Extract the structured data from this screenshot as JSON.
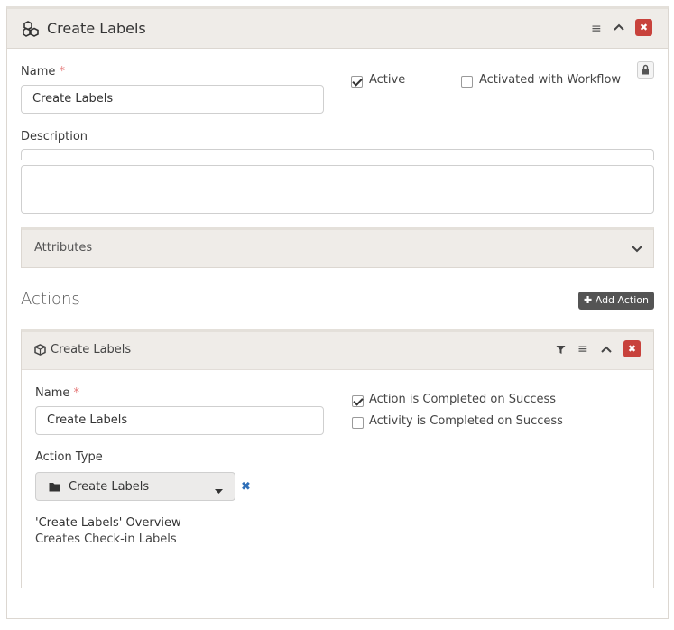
{
  "workflow": {
    "title": "Create Labels",
    "name_label": "Name",
    "required_mark": "*",
    "name_value": "Create Labels",
    "active_label": "Active",
    "active_checked": true,
    "activated_with_workflow_label": "Activated with Workflow",
    "activated_with_workflow_checked": false,
    "description_label": "Description",
    "description_value": "",
    "attributes_label": "Attributes"
  },
  "actions": {
    "heading": "Actions",
    "add_action_label": "Add Action",
    "item": {
      "title": "Create Labels",
      "name_label": "Name",
      "required_mark": "*",
      "name_value": "Create Labels",
      "completed_on_success_label": "Action is Completed on Success",
      "completed_on_success_checked": true,
      "activity_completed_label": "Activity is Completed on Success",
      "activity_completed_checked": false,
      "action_type_label": "Action Type",
      "action_type_value": "Create Labels",
      "overview_title": "'Create Labels' Overview",
      "overview_text": "Creates Check-in Labels"
    }
  },
  "colors": {
    "header_bg": "#efece8",
    "danger": "#c8423c",
    "dark_button": "#545454",
    "clear_x": "#2f6fb8"
  }
}
